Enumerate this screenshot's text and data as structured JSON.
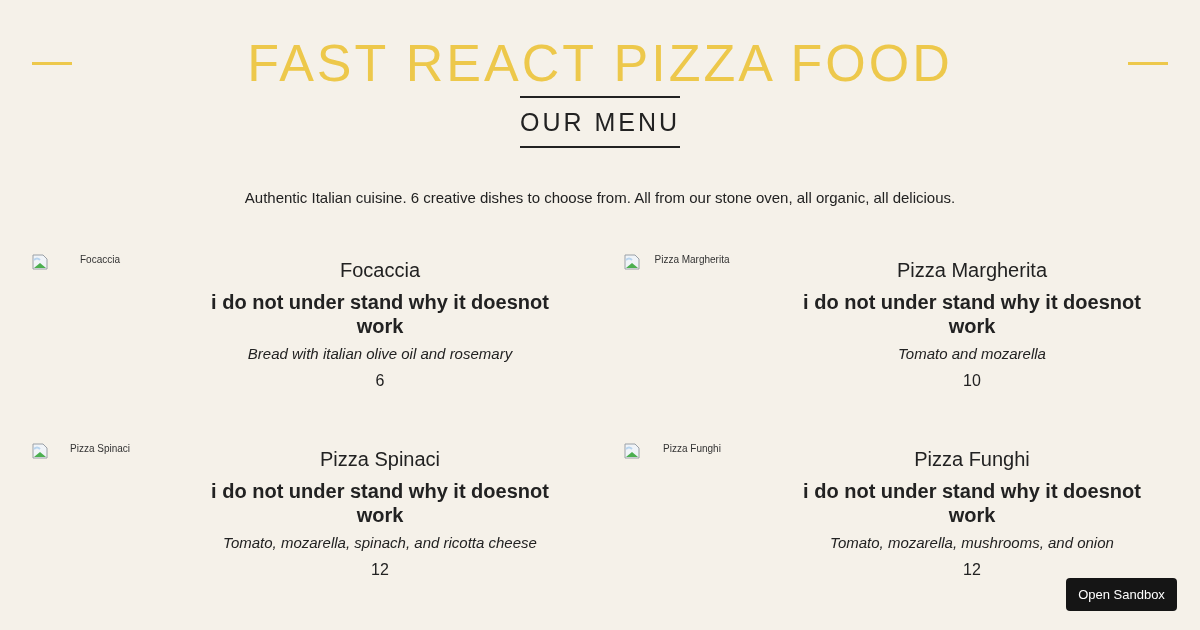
{
  "header": {
    "title": "FAST REACT PIZZA FOOD"
  },
  "menu": {
    "heading": "OUR MENU",
    "intro": "Authentic Italian cuisine. 6 creative dishes to choose from. All from our stone oven, all organic, all delicious.",
    "pizzas": [
      {
        "image_alt": "Focaccia",
        "name": "Focaccia",
        "note": "i do not under stand why it doesnot work",
        "ingredients": "Bread with italian olive oil and rosemary",
        "price": "6"
      },
      {
        "image_alt": "Pizza Margherita",
        "name": "Pizza Margherita",
        "note": "i do not under stand why it doesnot work",
        "ingredients": "Tomato and mozarella",
        "price": "10"
      },
      {
        "image_alt": "Pizza Spinaci",
        "name": "Pizza Spinaci",
        "note": "i do not under stand why it doesnot work",
        "ingredients": "Tomato, mozarella, spinach, and ricotta cheese",
        "price": "12"
      },
      {
        "image_alt": "Pizza Funghi",
        "name": "Pizza Funghi",
        "note": "i do not under stand why it doesnot work",
        "ingredients": "Tomato, mozarella, mushrooms, and onion",
        "price": "12"
      }
    ]
  },
  "sandbox_button": {
    "label": "Open Sandbox"
  }
}
